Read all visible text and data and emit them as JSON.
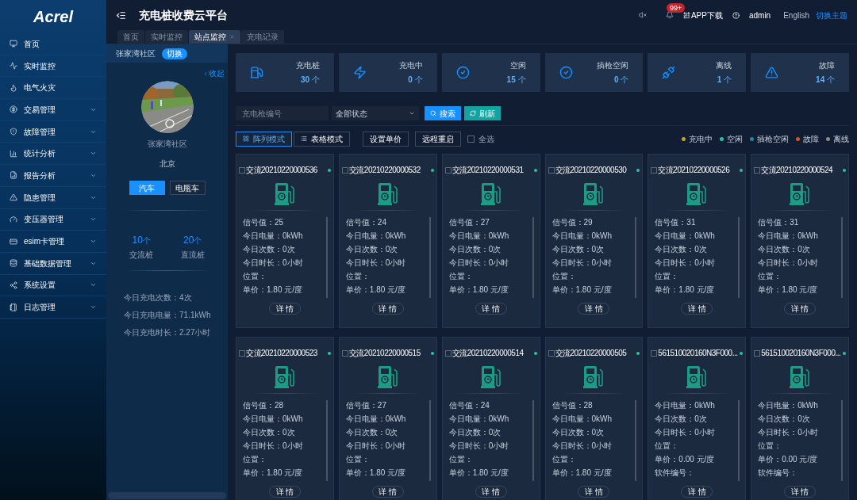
{
  "logo": "Acrel",
  "sidebar": {
    "items": [
      {
        "label": "首页",
        "has_submenu": false
      },
      {
        "label": "实时监控",
        "has_submenu": false
      },
      {
        "label": "电气火灾",
        "has_submenu": false
      },
      {
        "label": "交易管理",
        "has_submenu": true
      },
      {
        "label": "故障管理",
        "has_submenu": true
      },
      {
        "label": "统计分析",
        "has_submenu": true
      },
      {
        "label": "报告分析",
        "has_submenu": true
      },
      {
        "label": "隐患管理",
        "has_submenu": true
      },
      {
        "label": "变压器管理",
        "has_submenu": true
      },
      {
        "label": "esim卡管理",
        "has_submenu": true
      },
      {
        "label": "基础数据管理",
        "has_submenu": true
      },
      {
        "label": "系统设置",
        "has_submenu": true
      },
      {
        "label": "日志管理",
        "has_submenu": true
      }
    ]
  },
  "header": {
    "title": "充电桩收费云平台",
    "badge": "99+",
    "app_download": "APP下载",
    "user": "admin",
    "language": "English",
    "theme_switch": "切换主题"
  },
  "tabs": [
    {
      "label": "首页",
      "selected": false,
      "closable": false
    },
    {
      "label": "实时监控",
      "selected": false,
      "closable": false
    },
    {
      "label": "站点监控",
      "selected": true,
      "closable": true
    },
    {
      "label": "充电记录",
      "selected": false,
      "closable": false
    }
  ],
  "station": {
    "name": "张家湾社区",
    "switch": "切换",
    "collapse": "收起",
    "title": "张家湾社区",
    "city": "北京",
    "vehicle_types": [
      {
        "label": "汽车",
        "selected": true
      },
      {
        "label": "电瓶车",
        "selected": false
      }
    ],
    "counts": [
      {
        "value": "10",
        "unit": "个",
        "label": "交流桩"
      },
      {
        "value": "20",
        "unit": "个",
        "label": "直流桩"
      }
    ],
    "stats": [
      "今日充电次数：4次",
      "今日充电电量：71.1kWh",
      "今日充电时长：2.27小时"
    ]
  },
  "summary": [
    {
      "label": "充电桩",
      "value": "30",
      "unit": "个"
    },
    {
      "label": "充电中",
      "value": "0",
      "unit": "个"
    },
    {
      "label": "空闲",
      "value": "15",
      "unit": "个"
    },
    {
      "label": "插枪空闲",
      "value": "0",
      "unit": "个"
    },
    {
      "label": "离线",
      "value": "1",
      "unit": "个"
    },
    {
      "label": "故障",
      "value": "14",
      "unit": "个"
    }
  ],
  "filters": {
    "code_placeholder": "充电枪编号",
    "status": "全部状态",
    "search": "搜索",
    "refresh": "刷新"
  },
  "view_modes": [
    {
      "label": "阵列模式",
      "selected": true
    },
    {
      "label": "表格模式",
      "selected": false
    }
  ],
  "actions": [
    "设置单价",
    "远程重启"
  ],
  "select_all": {
    "label": "全选",
    "checked": false
  },
  "legend": [
    {
      "label": "充电中",
      "color": "#c9a227"
    },
    {
      "label": "空闲",
      "color": "#1fc7a0"
    },
    {
      "label": "插枪空闲",
      "color": "#1a8aa8"
    },
    {
      "label": "故障",
      "color": "#d9541e"
    },
    {
      "label": "离线",
      "color": "#8a8a8a"
    }
  ],
  "chargers": [
    {
      "id": "交流20210220000536",
      "color": "#1fc7a0",
      "checked": false,
      "lines": [
        "信号值：25",
        "今日电量：0kWh",
        "今日次数：0次",
        "今日时长：0小时",
        "位置：",
        "单价：1.80 元/度"
      ],
      "button": "详 情"
    },
    {
      "id": "交流20210220000532",
      "color": "#1fc7a0",
      "checked": false,
      "lines": [
        "信号值：24",
        "今日电量：0kWh",
        "今日次数：0次",
        "今日时长：0小时",
        "位置：",
        "单价：1.80 元/度"
      ],
      "button": "详 情"
    },
    {
      "id": "交流20210220000531",
      "color": "#1fc7a0",
      "checked": false,
      "lines": [
        "信号值：27",
        "今日电量：0kWh",
        "今日次数：0次",
        "今日时长：0小时",
        "位置：",
        "单价：1.80 元/度"
      ],
      "button": "详 情"
    },
    {
      "id": "交流20210220000530",
      "color": "#1fc7a0",
      "checked": false,
      "lines": [
        "信号值：29",
        "今日电量：0kWh",
        "今日次数：0次",
        "今日时长：0小时",
        "位置：",
        "单价：1.80 元/度"
      ],
      "button": "详 情"
    },
    {
      "id": "交流20210220000526",
      "color": "#1fc7a0",
      "checked": false,
      "lines": [
        "信号值：31",
        "今日电量：0kWh",
        "今日次数：0次",
        "今日时长：0小时",
        "位置：",
        "单价：1.80 元/度"
      ],
      "button": "详 情"
    },
    {
      "id": "交流20210220000524",
      "color": "#1fc7a0",
      "checked": false,
      "lines": [
        "信号值：31",
        "今日电量：0kWh",
        "今日次数：0次",
        "今日时长：0小时",
        "位置：",
        "单价：1.80 元/度"
      ],
      "button": "详 情"
    },
    {
      "id": "交流20210220000523",
      "color": "#1fc7a0",
      "checked": false,
      "lines": [
        "信号值：28",
        "今日电量：0kWh",
        "今日次数：0次",
        "今日时长：0小时",
        "位置：",
        "单价：1.80 元/度"
      ],
      "button": "详 情"
    },
    {
      "id": "交流20210220000515",
      "color": "#1fc7a0",
      "checked": false,
      "lines": [
        "信号值：27",
        "今日电量：0kWh",
        "今日次数：0次",
        "今日时长：0小时",
        "位置：",
        "单价：1.80 元/度"
      ],
      "button": "详 情"
    },
    {
      "id": "交流20210220000514",
      "color": "#1fc7a0",
      "checked": false,
      "lines": [
        "信号值：24",
        "今日电量：0kWh",
        "今日次数：0次",
        "今日时长：0小时",
        "位置：",
        "单价：1.80 元/度"
      ],
      "button": "详 情"
    },
    {
      "id": "交流20210220000505",
      "color": "#1fc7a0",
      "checked": false,
      "lines": [
        "信号值：28",
        "今日电量：0kWh",
        "今日次数：0次",
        "今日时长：0小时",
        "位置：",
        "单价：1.80 元/度"
      ],
      "button": "详 情"
    },
    {
      "id": "561510020160N3F000...",
      "color": "#1fc7a0",
      "checked": false,
      "lines": [
        "今日电量：0kWh",
        "今日次数：0次",
        "今日时长：0小时",
        "位置：",
        "单价：0.00 元/度",
        "软件编号："
      ],
      "button": "详 情"
    },
    {
      "id": "561510020160N3F000...",
      "color": "#1fc7a0",
      "checked": false,
      "lines": [
        "今日电量：0kWh",
        "今日次数：0次",
        "今日时长：0小时",
        "位置：",
        "单价：0.00 元/度",
        "软件编号："
      ],
      "button": "详 情"
    }
  ]
}
